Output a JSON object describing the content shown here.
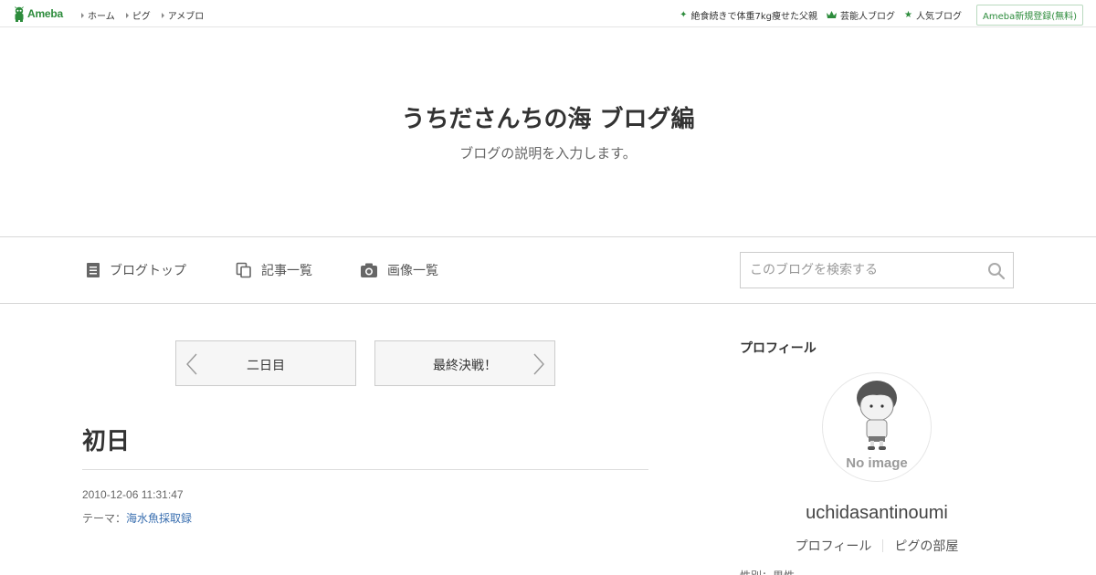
{
  "topbar": {
    "logo": "Ameba",
    "nav": [
      "ホーム",
      "ピグ",
      "アメブロ"
    ],
    "right_links": [
      {
        "icon": "sparkle-icon",
        "label": "絶食続きで体重7kg痩せた父親"
      },
      {
        "icon": "crown-icon",
        "label": "芸能人ブログ"
      },
      {
        "icon": "star-icon",
        "label": "人気ブログ"
      }
    ],
    "register": "Ameba新規登録(無料)",
    "accent_color": "#2d8c3c"
  },
  "header": {
    "title": "うちださんちの海 ブログ編",
    "description": "ブログの説明を入力します。"
  },
  "nav": {
    "blog_top": "ブログトップ",
    "entry_list": "記事一覧",
    "image_list": "画像一覧",
    "search_placeholder": "このブログを検索する"
  },
  "pager": {
    "prev": "二日目",
    "next": "最終決戦！"
  },
  "entry": {
    "title": "初日",
    "datetime": "2010-12-06 11:31:47",
    "theme_label": "テーマ：",
    "theme": "海水魚採取録"
  },
  "sidebar": {
    "heading": "プロフィール",
    "avatar_text": "No image",
    "username": "uchidasantinoumi",
    "links": [
      "プロフィール",
      "ピグの部屋"
    ],
    "cut_text": "性別：男性"
  }
}
